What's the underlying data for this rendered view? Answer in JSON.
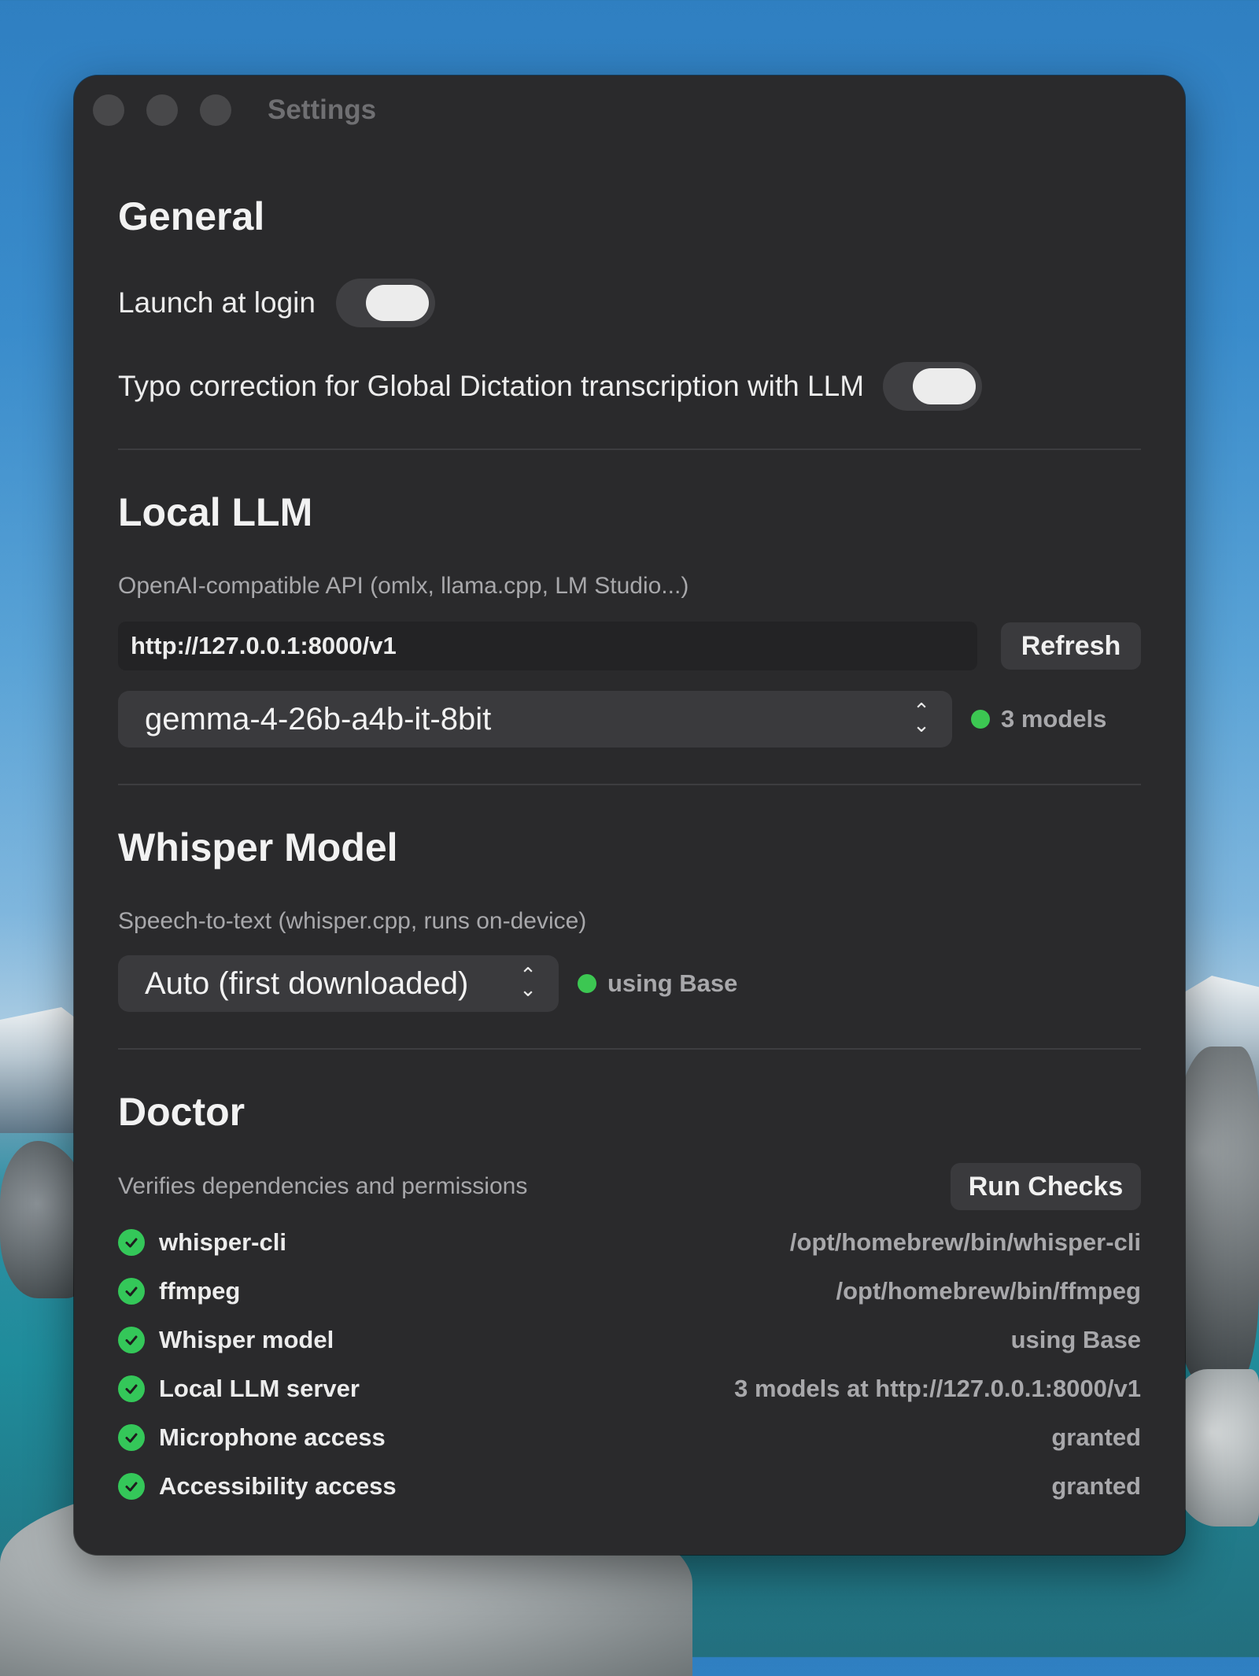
{
  "window": {
    "title": "Settings"
  },
  "general": {
    "title": "General",
    "launch_at_login": {
      "label": "Launch at login",
      "on": true
    },
    "typo_correction": {
      "label": "Typo correction for Global Dictation transcription with LLM",
      "on": true
    }
  },
  "local_llm": {
    "title": "Local LLM",
    "subtitle": "OpenAI-compatible API (omlx, llama.cpp, LM Studio...)",
    "api_url": "http://127.0.0.1:8000/v1",
    "refresh_label": "Refresh",
    "selected_model": "gemma-4-26b-a4b-it-8bit",
    "models_status": "3 models",
    "status_color": "#3cc752"
  },
  "whisper": {
    "title": "Whisper Model",
    "subtitle": "Speech-to-text (whisper.cpp, runs on-device)",
    "selected_model": "Auto (first downloaded)",
    "status": "using Base"
  },
  "doctor": {
    "title": "Doctor",
    "subtitle": "Verifies dependencies and permissions",
    "run_checks_label": "Run Checks",
    "checks": [
      {
        "name": "whisper-cli",
        "value": "/opt/homebrew/bin/whisper-cli",
        "ok": true
      },
      {
        "name": "ffmpeg",
        "value": "/opt/homebrew/bin/ffmpeg",
        "ok": true
      },
      {
        "name": "Whisper model",
        "value": "using Base",
        "ok": true
      },
      {
        "name": "Local LLM server",
        "value": "3 models at http://127.0.0.1:8000/v1",
        "ok": true
      },
      {
        "name": "Microphone access",
        "value": "granted",
        "ok": true
      },
      {
        "name": "Accessibility access",
        "value": "granted",
        "ok": true
      }
    ]
  }
}
